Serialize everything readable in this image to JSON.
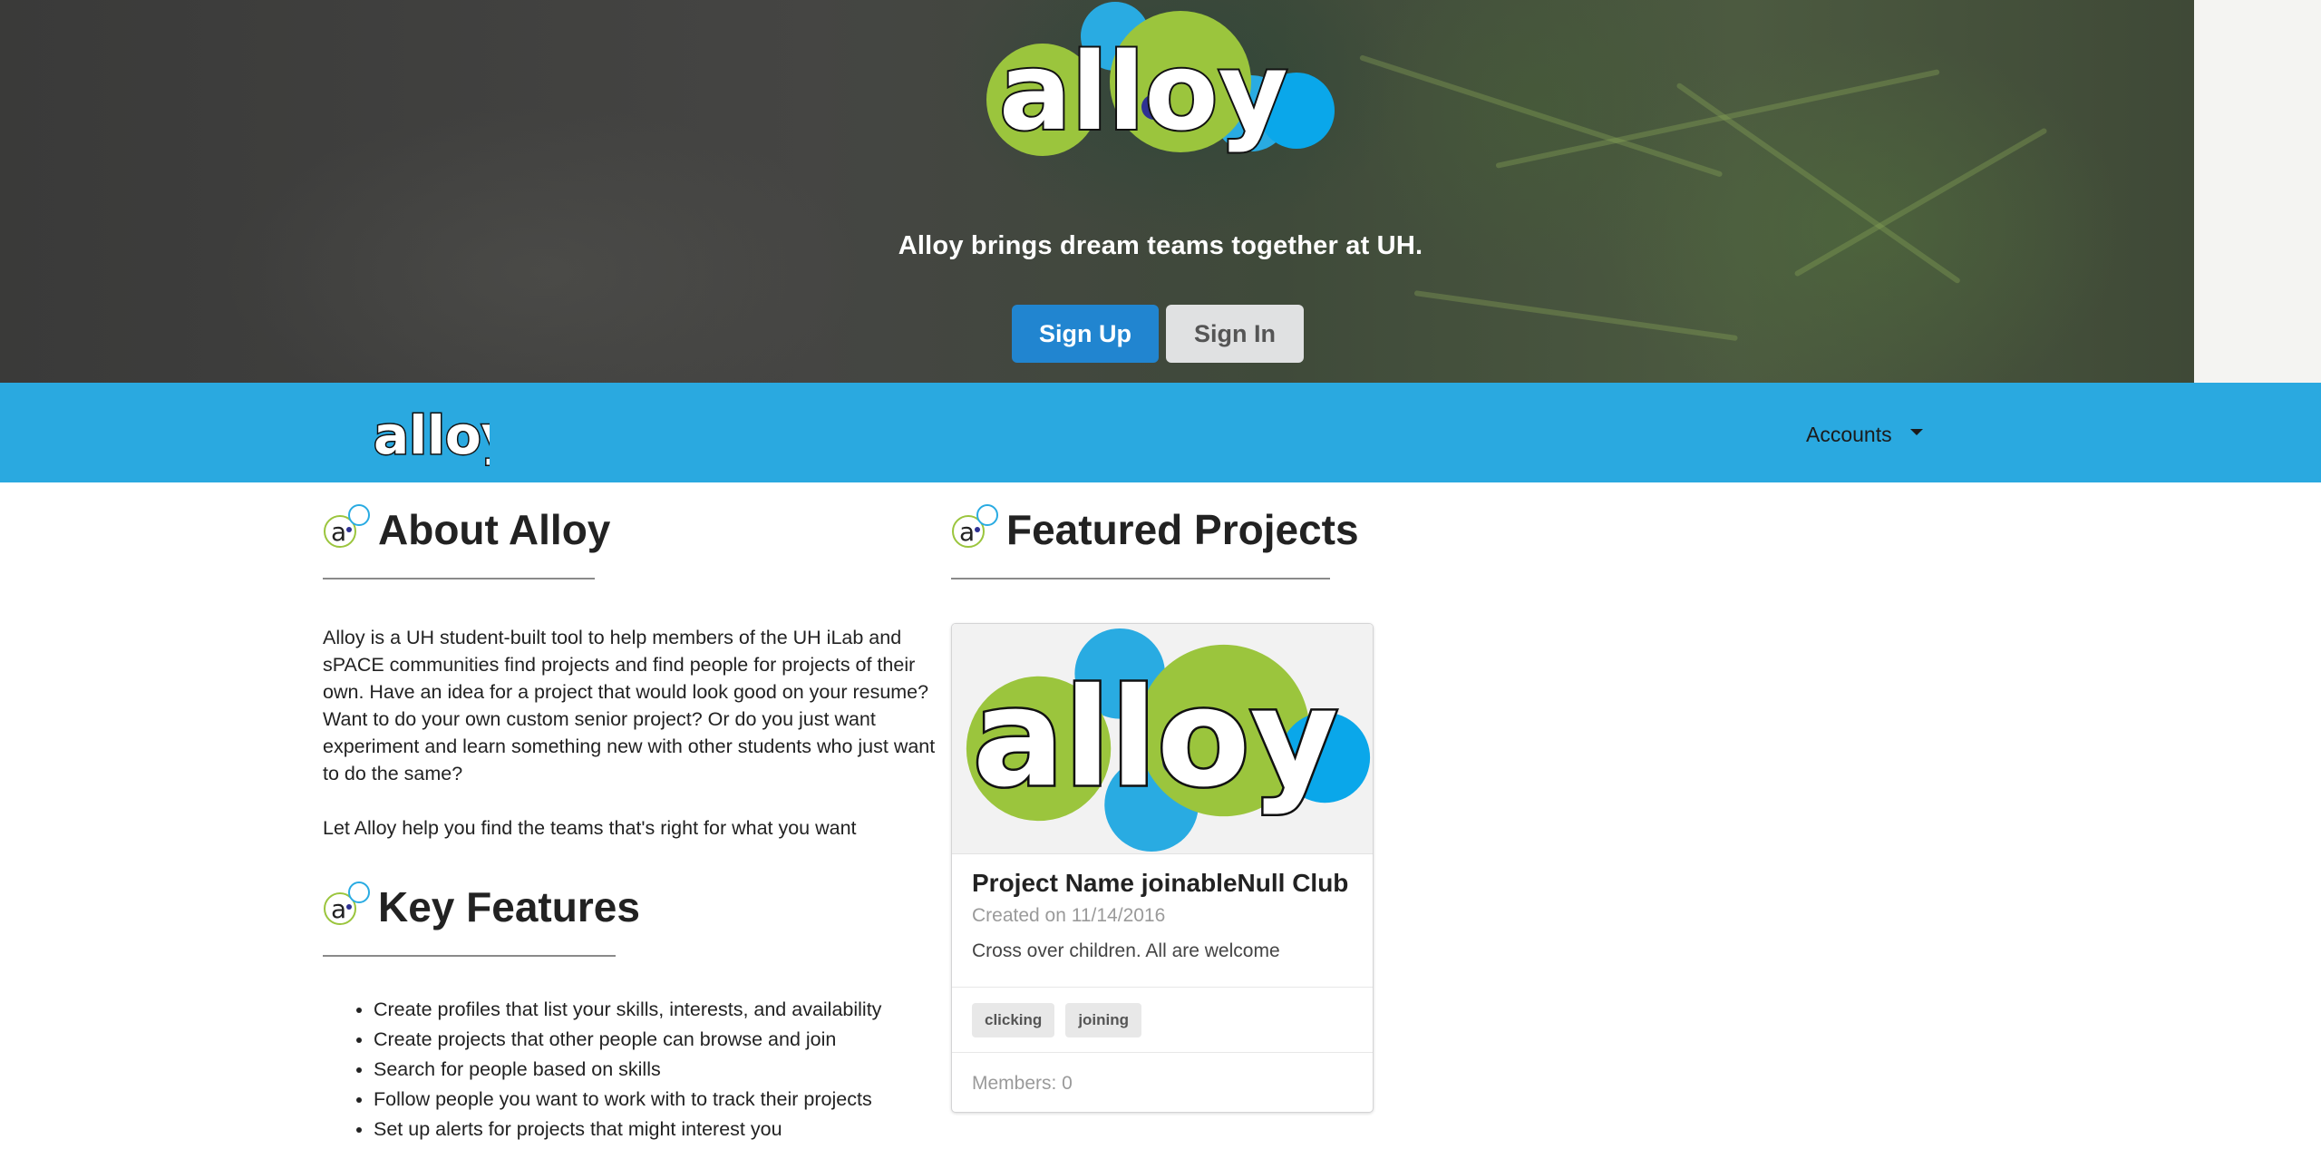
{
  "hero": {
    "logo_text": "alloy",
    "tagline": "Alloy brings dream teams together at UH.",
    "signup_label": "Sign Up",
    "signin_label": "Sign In"
  },
  "navbar": {
    "logo_text": "alloy",
    "accounts_label": "Accounts"
  },
  "about": {
    "title": "About Alloy",
    "paragraph1": "Alloy is a UH student-built tool to help members of the UH iLab and sPACE communities find projects and find people for projects of their own. Have an idea for a project that would look good on your resume? Want to do your own custom senior project? Or do you just want experiment and learn something new with other students who just want to do the same?",
    "paragraph2": "Let Alloy help you find the teams that's right for what you want"
  },
  "key_features": {
    "title": "Key Features",
    "items": [
      "Create profiles that list your skills, interests, and availability",
      "Create projects that other people can browse and join",
      "Search for people based on skills",
      "Follow people you want to work with to track their projects",
      "Set up alerts for projects that might interest you"
    ]
  },
  "featured": {
    "title": "Featured Projects",
    "card": {
      "image_text": "alloy",
      "name": "Project Name joinableNull Club",
      "created": "Created on 11/14/2016",
      "description": "Cross over children. All are welcome",
      "tags": [
        "clicking",
        "joining"
      ],
      "members": "Members: 0"
    }
  },
  "colors": {
    "nav_blue": "#2aa9e0",
    "signup_blue": "#2185d0",
    "logo_green": "#9bc53d",
    "logo_blue": "#29abe2",
    "logo_navy": "#2e3192"
  }
}
